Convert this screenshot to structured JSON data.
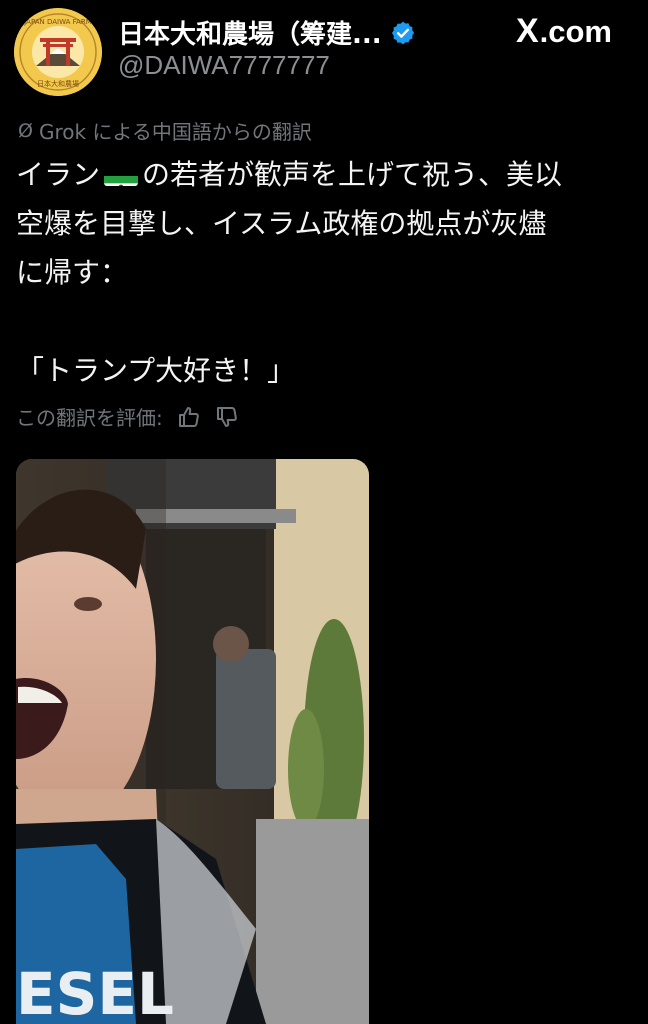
{
  "header": {
    "account_name": "日本大和農場（筹建...",
    "handle": "@DAIWA7777777",
    "site_brand": ".com",
    "site_brand_glyph": "X",
    "avatar_icon": "torii-farm-logo-icon",
    "avatar_ring_text": "JAPAN DAIWA FARM",
    "avatar_bottom_text": "日本大和農場"
  },
  "translation_note": "Grok による中国語からの翻訳",
  "tweet": {
    "line1_pre": "イラン",
    "line1_post": "の若者が歓声を上げて祝う、美以",
    "line2": "空爆を目撃し、イスラム政権の拠点が灰燼",
    "line3": "に帰す：",
    "line4": "「トランプ大好き！」",
    "flag_icon": "iran-flag-icon"
  },
  "rating": {
    "label": "この翻訳を評価:",
    "up_icon": "thumbs-up-icon",
    "down_icon": "thumbs-down-icon"
  },
  "media": {
    "shirt_text": "ESEL"
  },
  "colors": {
    "background": "#000000",
    "muted": "#71767b",
    "verified_blue": "#1d9bf0",
    "avatar_gold": "#f2c94c"
  }
}
